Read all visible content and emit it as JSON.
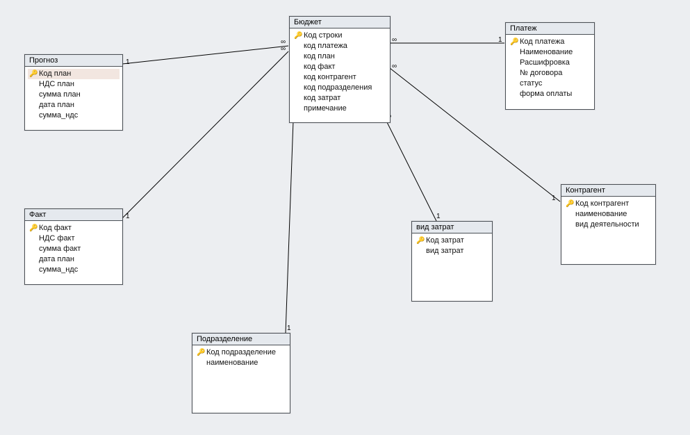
{
  "entities": {
    "prognoz": {
      "title": "Прогноз",
      "fields": [
        {
          "label": "Код план",
          "key": true,
          "selected": true
        },
        {
          "label": "НДС план",
          "key": false
        },
        {
          "label": "сумма план",
          "key": false
        },
        {
          "label": "дата план",
          "key": false
        },
        {
          "label": "сумма_ндс",
          "key": false
        }
      ]
    },
    "fact": {
      "title": "Факт",
      "fields": [
        {
          "label": "Код факт",
          "key": true
        },
        {
          "label": "НДС факт",
          "key": false
        },
        {
          "label": "сумма факт",
          "key": false
        },
        {
          "label": "дата план",
          "key": false
        },
        {
          "label": "сумма_ндс",
          "key": false
        }
      ]
    },
    "budget": {
      "title": "Бюджет",
      "fields": [
        {
          "label": "Код строки",
          "key": true
        },
        {
          "label": "код платежа",
          "key": false
        },
        {
          "label": "код план",
          "key": false
        },
        {
          "label": "код факт",
          "key": false
        },
        {
          "label": "код контрагент",
          "key": false
        },
        {
          "label": "код подразделения",
          "key": false
        },
        {
          "label": "код затрат",
          "key": false
        },
        {
          "label": "примечание",
          "key": false
        }
      ]
    },
    "payment": {
      "title": "Платеж",
      "fields": [
        {
          "label": "Код платежа",
          "key": true
        },
        {
          "label": "Наименование",
          "key": false
        },
        {
          "label": "Расшифровка",
          "key": false
        },
        {
          "label": "№ договора",
          "key": false
        },
        {
          "label": "статус",
          "key": false
        },
        {
          "label": "форма оплаты",
          "key": false
        }
      ]
    },
    "contractor": {
      "title": "Контрагент",
      "fields": [
        {
          "label": "Код контрагент",
          "key": true
        },
        {
          "label": "наименование",
          "key": false
        },
        {
          "label": "вид деятельности",
          "key": false
        }
      ]
    },
    "costType": {
      "title": "вид затрат",
      "fields": [
        {
          "label": "Код затрат",
          "key": true
        },
        {
          "label": "вид затрат",
          "key": false
        }
      ]
    },
    "division": {
      "title": "Подразделение",
      "fields": [
        {
          "label": "Код подразделение",
          "key": true
        },
        {
          "label": "наименование",
          "key": false
        }
      ]
    }
  },
  "relationships": [
    {
      "from": "prognoz",
      "from_card": "1",
      "to": "budget",
      "to_card": "∞"
    },
    {
      "from": "fact",
      "from_card": "1",
      "to": "budget",
      "to_card": "∞"
    },
    {
      "from": "payment",
      "from_card": "1",
      "to": "budget",
      "to_card": "∞"
    },
    {
      "from": "contractor",
      "from_card": "1",
      "to": "budget",
      "to_card": "∞"
    },
    {
      "from": "costType",
      "from_card": "1",
      "to": "budget",
      "to_card": "∞"
    },
    {
      "from": "division",
      "from_card": "1",
      "to": "budget",
      "to_card": "∞"
    }
  ],
  "rel_labels": {
    "one": "1",
    "many": "∞"
  }
}
